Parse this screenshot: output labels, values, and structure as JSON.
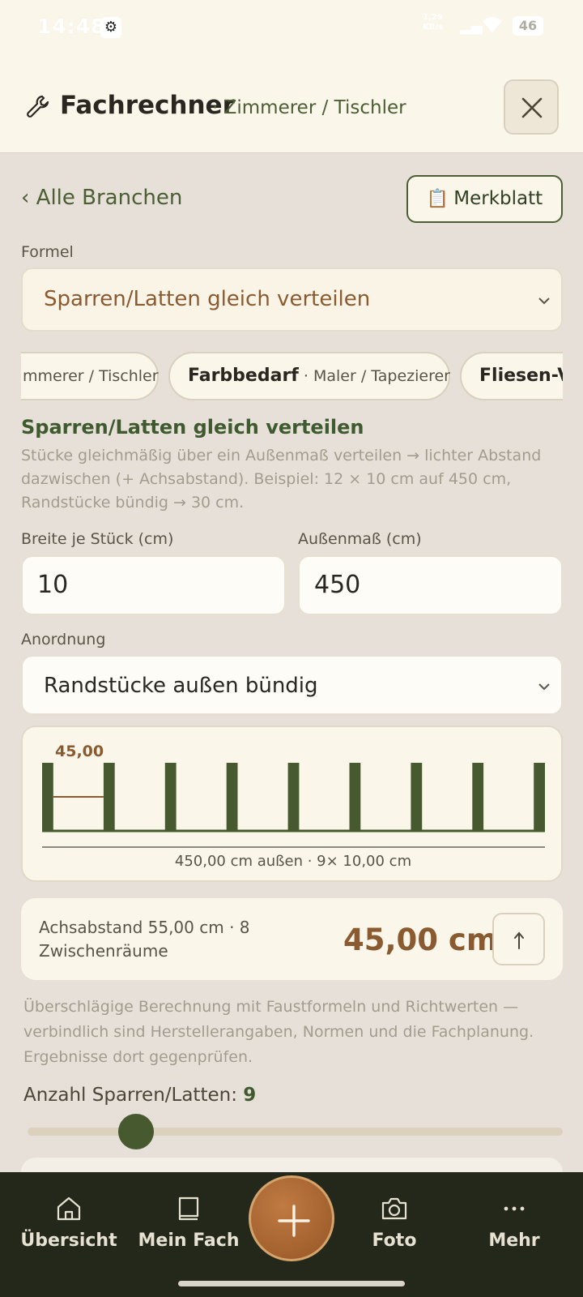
{
  "status_bar": {
    "time": "14:48",
    "net_speed": "1,29",
    "net_unit": "KB/s",
    "battery": "46"
  },
  "header": {
    "title": "Fachrechner",
    "subtitle": "· Zimmerer / Tischler",
    "close_icon": "close-icon",
    "wrench_icon": "wrench-icon"
  },
  "nav_back": "‹ Alle Branchen",
  "merkblatt": {
    "icon": "📋",
    "label": "Merkblatt"
  },
  "formula": {
    "label": "Formel",
    "value": "Sparren/Latten gleich verteilen"
  },
  "chips": [
    {
      "name": "",
      "branch": "mmerer / Tischler"
    },
    {
      "name": "Farbbedarf",
      "branch": " · Maler / Tapezierer"
    },
    {
      "name": "Fliesen-Ve",
      "branch": ""
    }
  ],
  "section": {
    "title": "Sparren/Latten gleich verteilen",
    "description": "Stücke gleichmäßig über ein Außenmaß verteilen → lichter Abstand dazwischen (+ Achsabstand). Beispiel: 12 × 10 cm auf 450 cm, Randstücke bündig → 30 cm."
  },
  "inputs": {
    "width_label": "Breite je Stück (cm)",
    "width_value": "10",
    "outer_label": "Außenmaß (cm)",
    "outer_value": "450"
  },
  "arrangement": {
    "label": "Anordnung",
    "value": "Randstücke außen bündig"
  },
  "diagram": {
    "gap_label": "45,00",
    "caption": "450,00 cm außen · 9× 10,00 cm",
    "pieces": 9,
    "outer": 450,
    "piece_width": 10,
    "gap": 45,
    "piece_color": "#46592f"
  },
  "result": {
    "info": "Achsabstand 55,00 cm · 8 Zwischenräume",
    "value": "45,00 cm",
    "share_icon": "share-arrow-icon"
  },
  "disclaimer": "Überschlägige Berechnung mit Faustformeln und Richtwerten — verbindlich sind Herstellerangaben, Normen und die Fachplanung. Ergebnisse dort gegenprüfen.",
  "count": {
    "label": "Anzahl Sparren/Latten:",
    "value": "9"
  },
  "slider": {
    "value": 9,
    "position_fraction": 0.2
  },
  "bottom_nav": [
    {
      "label": "Übersicht",
      "icon": "home-icon"
    },
    {
      "label": "Mein Fach",
      "icon": "book-icon"
    },
    {
      "label": "Foto",
      "icon": "camera-icon"
    },
    {
      "label": "Mehr",
      "icon": "more-icon"
    }
  ],
  "fab_icon": "plus-icon",
  "colors": {
    "accent_green": "#46592f",
    "accent_brown": "#8a5a30",
    "nav_bg": "#23281a"
  }
}
